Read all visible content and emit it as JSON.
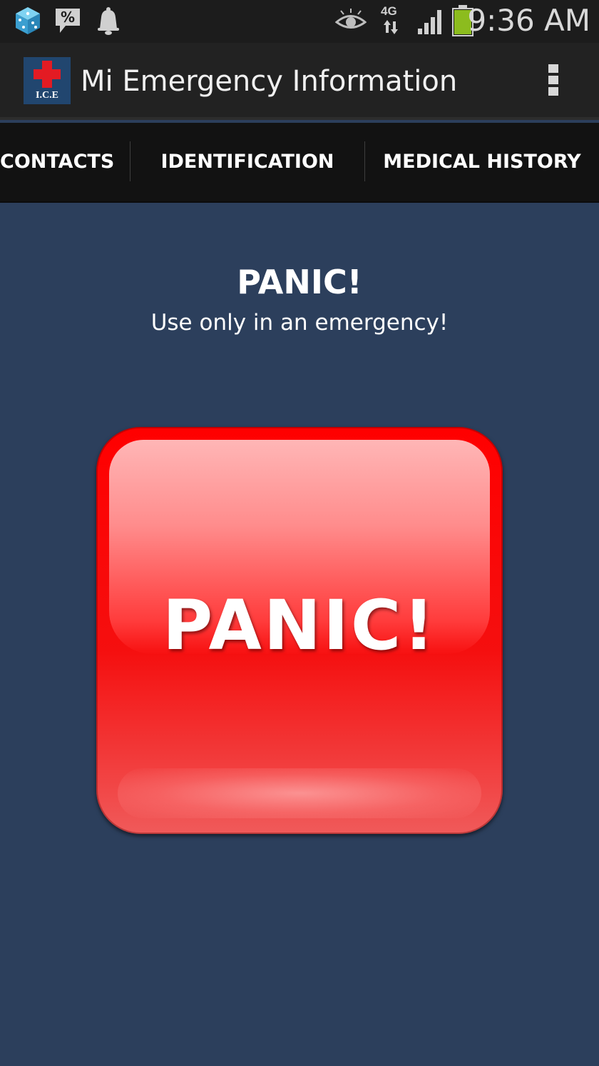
{
  "status_bar": {
    "time": "9:36 AM",
    "network_type": "4G",
    "left_icons": [
      "dice-icon",
      "percent-chat-icon",
      "bell-icon"
    ],
    "right_icons": [
      "eye-icon",
      "network-arrows-icon",
      "signal-icon",
      "battery-icon"
    ],
    "battery_color": "#8cbc1e"
  },
  "action_bar": {
    "title": "Mi Emergency Information",
    "logo_text": "I.C.E",
    "logo_color": "#21466f",
    "cross_color": "#e31b23"
  },
  "tabs": [
    {
      "label": "CONTACTS"
    },
    {
      "label": "IDENTIFICATION"
    },
    {
      "label": "MEDICAL HISTORY"
    }
  ],
  "main": {
    "heading": "PANIC!",
    "subtitle": "Use only in an emergency!",
    "panic_button_label": "PANIC!",
    "background_color": "#2c3f5c",
    "button_color": "#ff0000"
  }
}
